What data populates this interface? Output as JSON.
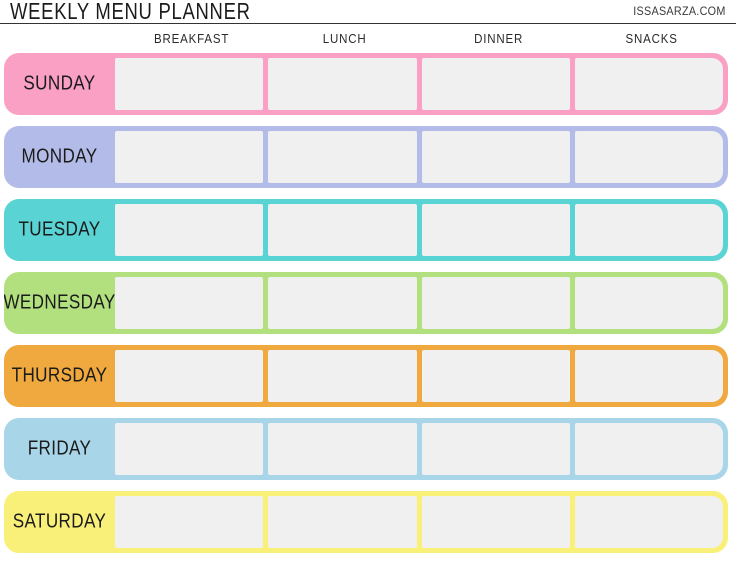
{
  "header": {
    "title": "Weekly Menu Planner",
    "watermark": "issasarza.com"
  },
  "columns": [
    {
      "label": "Breakfast"
    },
    {
      "label": "Lunch"
    },
    {
      "label": "Dinner"
    },
    {
      "label": "Snacks"
    }
  ],
  "rows": [
    {
      "day": "Sunday",
      "color": "#f9a0c4"
    },
    {
      "day": "Monday",
      "color": "#b3bce8"
    },
    {
      "day": "Tuesday",
      "color": "#59d3d3"
    },
    {
      "day": "Wednesday",
      "color": "#b2e07f"
    },
    {
      "day": "Thursday",
      "color": "#f0a93e"
    },
    {
      "day": "Friday",
      "color": "#a8d6e8"
    },
    {
      "day": "Saturday",
      "color": "#f9f07a"
    }
  ],
  "cell_values": [
    [
      "",
      "",
      "",
      ""
    ],
    [
      "",
      "",
      "",
      ""
    ],
    [
      "",
      "",
      "",
      ""
    ],
    [
      "",
      "",
      "",
      ""
    ],
    [
      "",
      "",
      "",
      ""
    ],
    [
      "",
      "",
      "",
      ""
    ],
    [
      "",
      "",
      "",
      ""
    ]
  ]
}
